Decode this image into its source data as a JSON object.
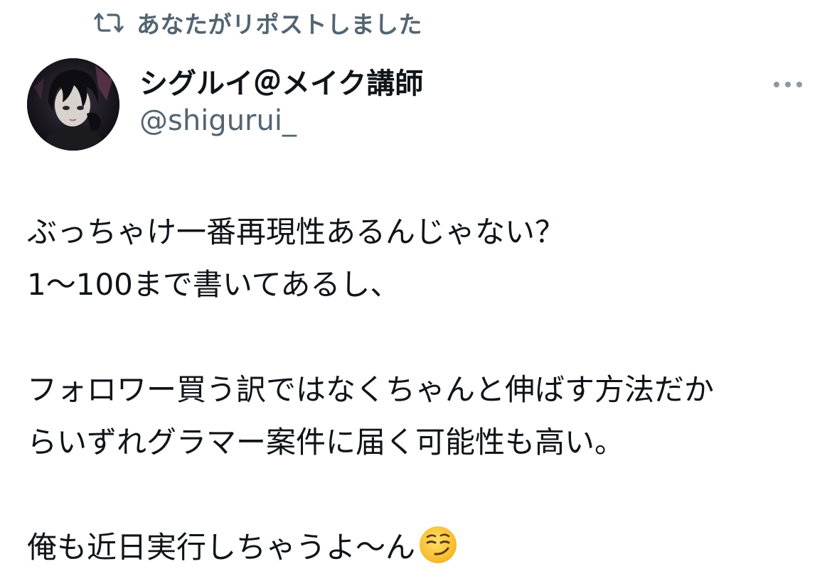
{
  "repost_banner": {
    "icon": "repost-icon",
    "text": "あなたがリポストしました"
  },
  "author": {
    "display_name": "シグルイ＠メイク講師",
    "handle": "@shigurui_",
    "avatar": "avatar-image"
  },
  "more_menu": {
    "icon": "more-dots-icon"
  },
  "tweet": {
    "lines": [
      "ぶっちゃけ一番再現性あるんじゃない？",
      "1〜100まで書いてあるし、",
      "",
      "フォロワー買う訳ではなくちゃんと伸ばす方法だか",
      "らいずれグラマー案件に届く可能性も高い。",
      "",
      "俺も近日実行しちゃうよ〜ん"
    ],
    "emoji": "smirking-face-emoji"
  },
  "colors": {
    "text": "#0f1419",
    "secondary": "#536471",
    "background": "#ffffff"
  }
}
